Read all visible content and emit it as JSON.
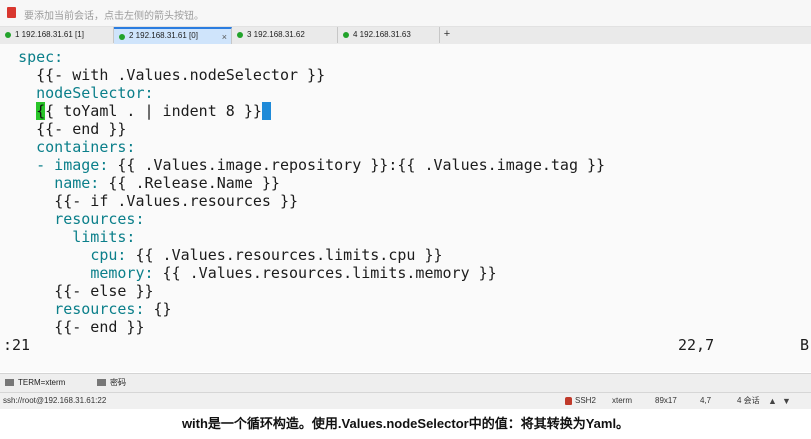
{
  "hint": {
    "text": "要添加当前会话，点击左侧的箭头按钮。",
    "icon": "bookmark-icon"
  },
  "tabs": [
    {
      "label": "1 192.168.31.61 [1]",
      "active": false
    },
    {
      "label": "2 192.168.31.61 [0]",
      "active": true
    },
    {
      "label": "3 192.168.31.62",
      "active": false
    },
    {
      "label": "4 192.168.31.63",
      "active": false
    }
  ],
  "tab_close": "×",
  "tab_add": "+",
  "editor": {
    "lines": [
      {
        "indent": "  ",
        "key": "spec:",
        "rest": ""
      },
      {
        "indent": "    ",
        "key": "",
        "rest": "{{- with .Values.nodeSelector }}"
      },
      {
        "indent": "    ",
        "key": "nodeSelector:",
        "rest": ""
      },
      {
        "indent": "    ",
        "cursor_start": "{",
        "rest": "{ toYaml . | indent 8 }",
        "cursor_end": "}"
      },
      {
        "indent": "    ",
        "key": "",
        "rest": "{{- end }}"
      },
      {
        "indent": "    ",
        "key": "containers:",
        "rest": ""
      },
      {
        "indent": "    ",
        "key": "- image:",
        "rest": " {{ .Values.image.repository }}:{{ .Values.image.tag }}"
      },
      {
        "indent": "      ",
        "key": "name:",
        "rest": " {{ .Release.Name }}"
      },
      {
        "indent": "      ",
        "key": "",
        "rest": "{{- if .Values.resources }}"
      },
      {
        "indent": "      ",
        "key": "resources:",
        "rest": ""
      },
      {
        "indent": "        ",
        "key": "limits:",
        "rest": ""
      },
      {
        "indent": "          ",
        "key": "cpu:",
        "rest": " {{ .Values.resources.limits.cpu }}"
      },
      {
        "indent": "          ",
        "key": "memory:",
        "rest": " {{ .Values.resources.limits.memory }}"
      },
      {
        "indent": "      ",
        "key": "",
        "rest": "{{- else }}"
      },
      {
        "indent": "      ",
        "key": "resources:",
        "rest": " {}"
      },
      {
        "indent": "      ",
        "key": "",
        "rest": "{{- end }}"
      }
    ],
    "status_left": ":21",
    "status_right": "22,7",
    "status_end": "B"
  },
  "bottombar": {
    "term_label": "TERM=xterm",
    "password_label": "密码"
  },
  "statusbar": {
    "connection": "ssh://root@192.168.31.61:22",
    "protocol": "SSH2",
    "terminal": "xterm",
    "size": "89x17",
    "position": "4,7",
    "sessions": "4 会话"
  },
  "subtitle": "with是一个循环构造。使用.Values.nodeSelector中的值：将其转换为Yaml。",
  "colors": {
    "tab_active": "#cfe4fb",
    "keyword": "#0b7f8a",
    "cursor_green": "#28c428",
    "cursor_blue": "#1f8ad8"
  }
}
